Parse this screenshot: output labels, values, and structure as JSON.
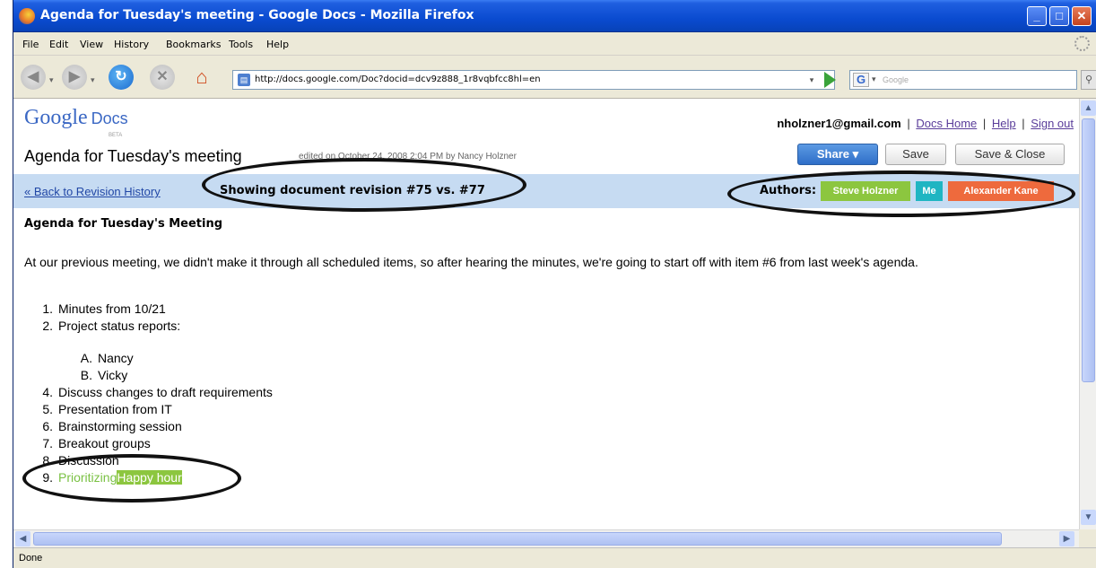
{
  "window": {
    "title": "Agenda for Tuesday's meeting - Google Docs - Mozilla Firefox",
    "minimize": "_",
    "maximize": "□",
    "close": "✕"
  },
  "menu": [
    "File",
    "Edit",
    "View",
    "History",
    "Bookmarks",
    "Tools",
    "Help"
  ],
  "nav": {
    "url": "http://docs.google.com/Doc?docid=dcv9z888_1r8vqbfcc8hl=en",
    "search_placeholder": "Google",
    "back_glyph": "◀",
    "forward_glyph": "▶",
    "home_glyph": "⌂",
    "dropdown_glyph": "▾",
    "search_glyph": "🔍",
    "g_glyph": "G"
  },
  "app": {
    "logo_google": "Google",
    "logo_docs": "Docs",
    "beta": "BETA",
    "account_email": "nholzner1@gmail.com",
    "docs_home": "Docs Home",
    "help": "Help",
    "sign_out": "Sign out",
    "separator": "|"
  },
  "document": {
    "title": "Agenda for Tuesday's meeting",
    "edited": "edited on October 24, 2008 2:04 PM by Nancy Holzner",
    "share_label": "Share ▾",
    "save_label": "Save",
    "save_close_label": "Save & Close"
  },
  "revision": {
    "back_link": "« Back to Revision History",
    "showing": "Showing document revision #75 vs. #77",
    "authors_label": "Authors:",
    "authors": [
      {
        "name": "Steve Holzner",
        "color": "#8cc63f"
      },
      {
        "name": "Me",
        "color": "#1fb5c2"
      },
      {
        "name": "Alexander Kane",
        "color": "#ee6a3d"
      }
    ]
  },
  "content": {
    "heading": "Agenda for Tuesday's Meeting",
    "paragraph": "At our previous meeting, we didn't make it through all scheduled items, so after hearing the minutes, we're going to start off with item #6 from last week's agenda.",
    "items": [
      {
        "num": "1.",
        "text": "Minutes from 10/21"
      },
      {
        "num": "2.",
        "text": "Project status reports:"
      },
      {
        "num": "A.",
        "text": "Nancy"
      },
      {
        "num": "B.",
        "text": "Vicky"
      },
      {
        "num": "4.",
        "text": "Discuss changes to draft requirements"
      },
      {
        "num": "5.",
        "text": "Presentation from IT"
      },
      {
        "num": "6.",
        "text": "Brainstorming session"
      },
      {
        "num": "7.",
        "text": "Breakout groups"
      },
      {
        "num": "8.",
        "text": "Discussion"
      },
      {
        "num": "9.",
        "text": "Prioritizing",
        "highlight": "Happy hour"
      }
    ]
  },
  "status": "Done"
}
